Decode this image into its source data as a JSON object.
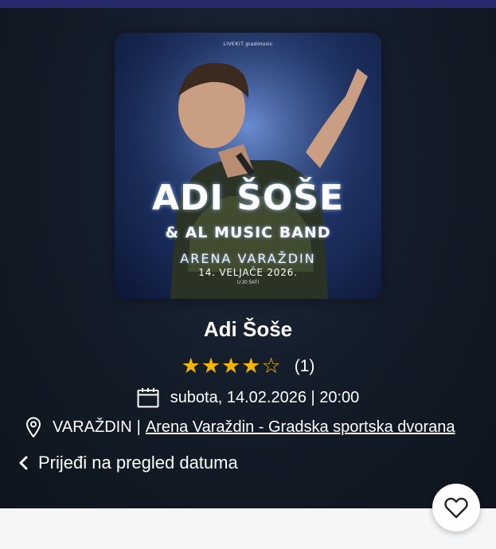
{
  "poster": {
    "small_top": "LIVEKIT gradimusic",
    "artist": "ADI ŠOŠE",
    "band": "& AL MUSIC BAND",
    "venue": "ARENA VARAŽDIN",
    "date": "14. VELJAČE 2026.",
    "time": "U 20 SATI"
  },
  "event": {
    "title": "Adi Šoše",
    "rating_value": 4,
    "rating_max": 5,
    "rating_count": "(1)",
    "datetime": "subota, 14.02.2026 | 20:00",
    "city": "VARAŽDIN",
    "separator": "|",
    "venue_link": "Arena Varaždin - Gradska sportska dvorana"
  },
  "nav": {
    "back_label": "Prijeđi na pregled datuma"
  },
  "icons": {
    "calendar": "calendar-icon",
    "location": "location-pin-icon",
    "back": "chevron-left-icon",
    "favorite": "heart-outline-icon"
  },
  "colors": {
    "top_bar": "#262a6b",
    "star": "#f4b400",
    "hero_bg": "#121b27"
  }
}
